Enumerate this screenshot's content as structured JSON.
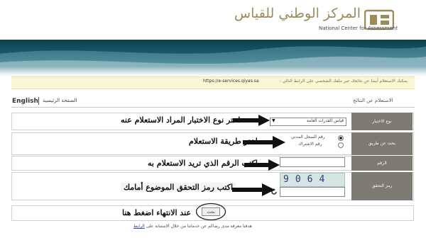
{
  "header": {
    "logo_arabic": "المركز الوطني للقياس",
    "logo_english": "National Center for Assessment",
    "logo_mark": "qiyas-logo"
  },
  "notice": {
    "text": "يمكنك الاستعلام أيضا عن نتائجك عبر ملفك الشخصي على الرابط التالي :",
    "link": "https://e-services.qiyas.sa"
  },
  "nav": {
    "english": "English",
    "home": "الصفحة الرئيسية",
    "page_title": "الاستعلام عن النتائج"
  },
  "form": {
    "exam_type_label": "نوع الاختبار",
    "exam_type_value": "قياس القدرات العامة",
    "search_by_label": "بحث عن طريق",
    "options": [
      "رقم السجل المدني",
      "رقم الاشتراك"
    ],
    "number_label": "الرقم",
    "number_value": "",
    "captcha_label": "رمز التحقق",
    "captcha_text": "9064",
    "captcha_value": "",
    "search_button": "بحث"
  },
  "annotations": {
    "step1": "اختر نوع الاختبار المراد الاستعلام عنه",
    "step2": "اختر طريقة الاستعلام",
    "step3": "اكتب الرقم الذي تريد الاستعلام به",
    "step4": "اكتب رمز التحقق الموضوع أمامك",
    "step5": "عند الانتهاء اضغط هنا"
  },
  "footer": {
    "text": "هدفنا معرفة مدى رضاكم عن خدماتنا من خلال الاستبانة على",
    "link": "الرابط"
  },
  "colors": {
    "label_bg": "#7d7a74",
    "banner": "#14566a",
    "logo_gold": "#9c8c5a",
    "notice_bg": "#fbf6d6"
  }
}
